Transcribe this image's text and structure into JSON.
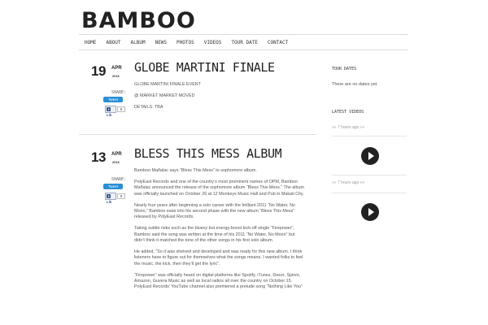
{
  "site": {
    "logo": "BAMBOO"
  },
  "nav": [
    "HOME",
    "ABOUT",
    "ALBUM",
    "NEWS",
    "PHOTOS",
    "VIDEOS",
    "TOUR DATE",
    "CONTACT"
  ],
  "posts": [
    {
      "day": "19",
      "month": "APR",
      "year": "2016",
      "title": "GLOBE MARTINI FINALE",
      "share_label": "SHARE:",
      "tweet_label": "Tweet",
      "like_label": "Lik",
      "like_count": "0",
      "body": [
        "GLOBE MARTINI FINALE EVENT",
        "@ MARKET MARKET MOVED",
        "DETAILS: TBA"
      ]
    },
    {
      "day": "13",
      "month": "APR",
      "year": "2016",
      "title": "BLESS THIS MESS ALBUM",
      "share_label": "SHARE:",
      "tweet_label": "Tweet",
      "like_label": "Lik",
      "like_count": "0",
      "body": [
        "Bamboo Mañalac says “Bless This Mess” to sophomore album.",
        "PolyEast Records and one of the country’s most prominent names of OPM, Bamboo Mañalac announced the release of the sophomore album “Bless This Mess.” The album was officially launched on October 26 at 12 Monkeys Music Hall and Pub in Makati City.",
        "Nearly four years after beginning a solo career with the brilliant 2011 “No Water, No Moon,” Bamboo ease into his second phase with the new album “Bless This Mess” released by PolyEast Records.",
        "Taking subtle risks such as the bluesy but energy-boost kick-off single “Firepower”, Bamboo said the song was written at the time of his 2011 “No Water, No Moon” but didn’t think it matched the tone of the other songs in his first solo album.",
        "He added, “So it was shelved and developed and was ready for this new album. I think listeners have to figure out for themselves what the songs means. I wanted folks to feel the music, the kick, then they’ll get the lyric”.",
        "“Firepower” was officially heard on digital platforms like Spotify, iTunes, Deezr, Spinnr, Amazon, Guvera Music as well as local radios all over the country on October 15. PolyEast Records’ YouTube channel also premiered a prelude song “Nothing Like You”"
      ]
    }
  ],
  "sidebar": {
    "tour_title": "TOUR DATES",
    "tour_text": "There are no dates yet.",
    "videos_title": "LATEST VIDEOS",
    "video_meta_1": "»» 7 hours ago »»",
    "video_meta_2": "»» 7 hours ago »»"
  }
}
